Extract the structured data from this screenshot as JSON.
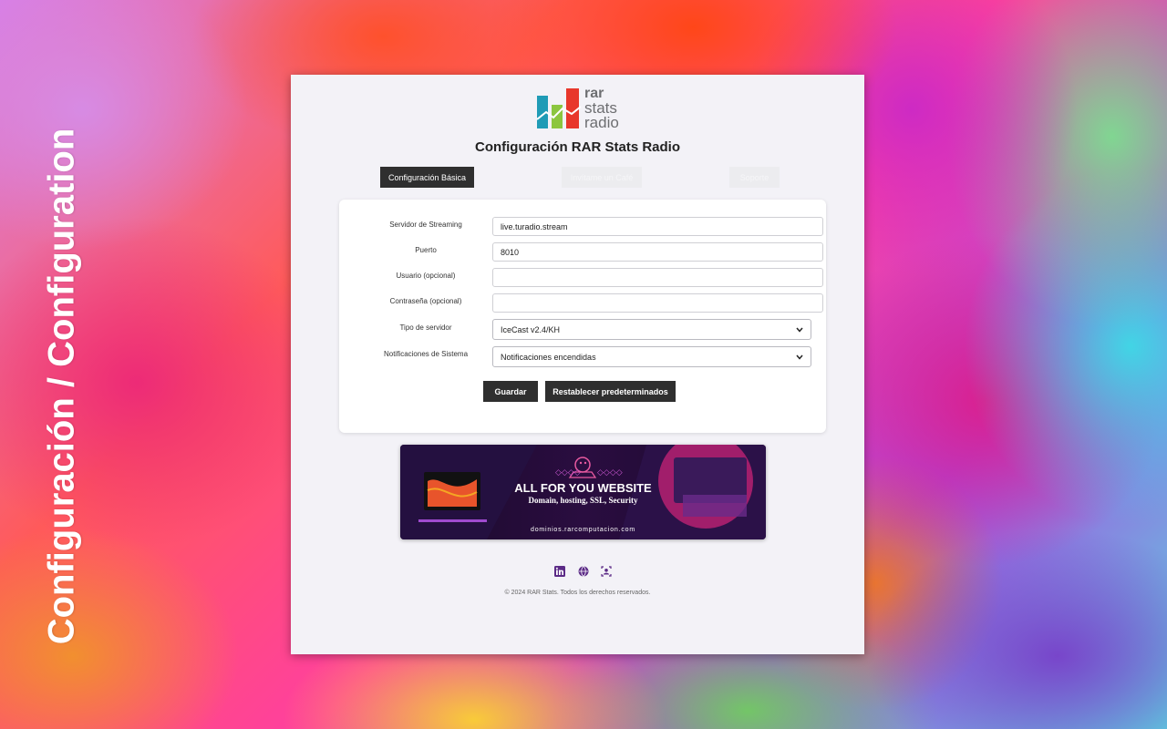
{
  "side_title": "Configuración / Configuration",
  "logo": {
    "line1": "rar",
    "line2": "stats",
    "line3": "radio"
  },
  "heading": "Configuración RAR Stats Radio",
  "tabs": [
    {
      "label": "Configuración Básica",
      "active": true
    },
    {
      "label": "Invítame un Café",
      "active": false
    },
    {
      "label": "Soporte",
      "active": false
    }
  ],
  "form": {
    "server_label": "Servidor de Streaming",
    "server_value": "live.turadio.stream",
    "port_label": "Puerto",
    "port_value": "8010",
    "user_label": "Usuario (opcional)",
    "user_value": "",
    "password_label": "Contraseña (opcional)",
    "password_value": "",
    "server_type_label": "Tipo de servidor",
    "server_type_value": "IceCast v2.4/KH",
    "notifications_label": "Notificaciones de Sistema",
    "notifications_value": "Notificaciones encendidas",
    "save_label": "Guardar",
    "reset_label": "Restablecer predeterminados"
  },
  "banner": {
    "headline": "ALL FOR YOU WEBSITE",
    "subline": "Domain, hosting, SSL, Security",
    "url": "dominios.rarcomputacion.com"
  },
  "social_icons": [
    "linkedin-icon",
    "globe-icon",
    "user-profile-icon"
  ],
  "footer": "© 2024 RAR Stats. Todos los derechos reservados.",
  "colors": {
    "dark_button": "#2f2f2f",
    "panel_bg": "#f3f2f7",
    "icon_purple": "#5b2a86"
  }
}
